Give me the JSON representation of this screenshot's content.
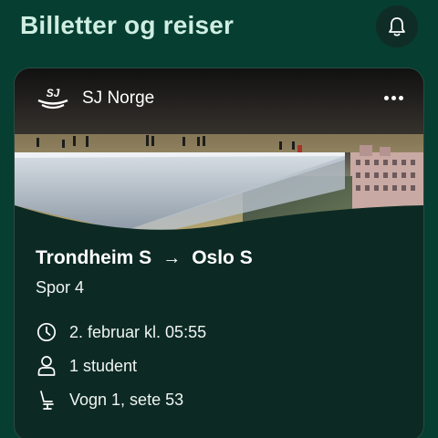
{
  "header": {
    "title": "Billetter og reiser",
    "bell_icon": "bell-icon"
  },
  "ticket": {
    "operator": {
      "name": "SJ Norge",
      "logo": "SJ"
    },
    "more_icon": "more-horizontal-icon",
    "route": {
      "from": "Trondheim S",
      "arrow": "→",
      "to": "Oslo S"
    },
    "track": "Spor 4",
    "details": [
      {
        "icon": "clock-icon",
        "text": "2. februar kl. 05:55"
      },
      {
        "icon": "person-icon",
        "text": "1 student"
      },
      {
        "icon": "seat-icon",
        "text": "Vogn 1, sete 53"
      }
    ]
  },
  "colors": {
    "background": "#063e31",
    "title": "#cfeee2",
    "card": "#0c2a23"
  }
}
